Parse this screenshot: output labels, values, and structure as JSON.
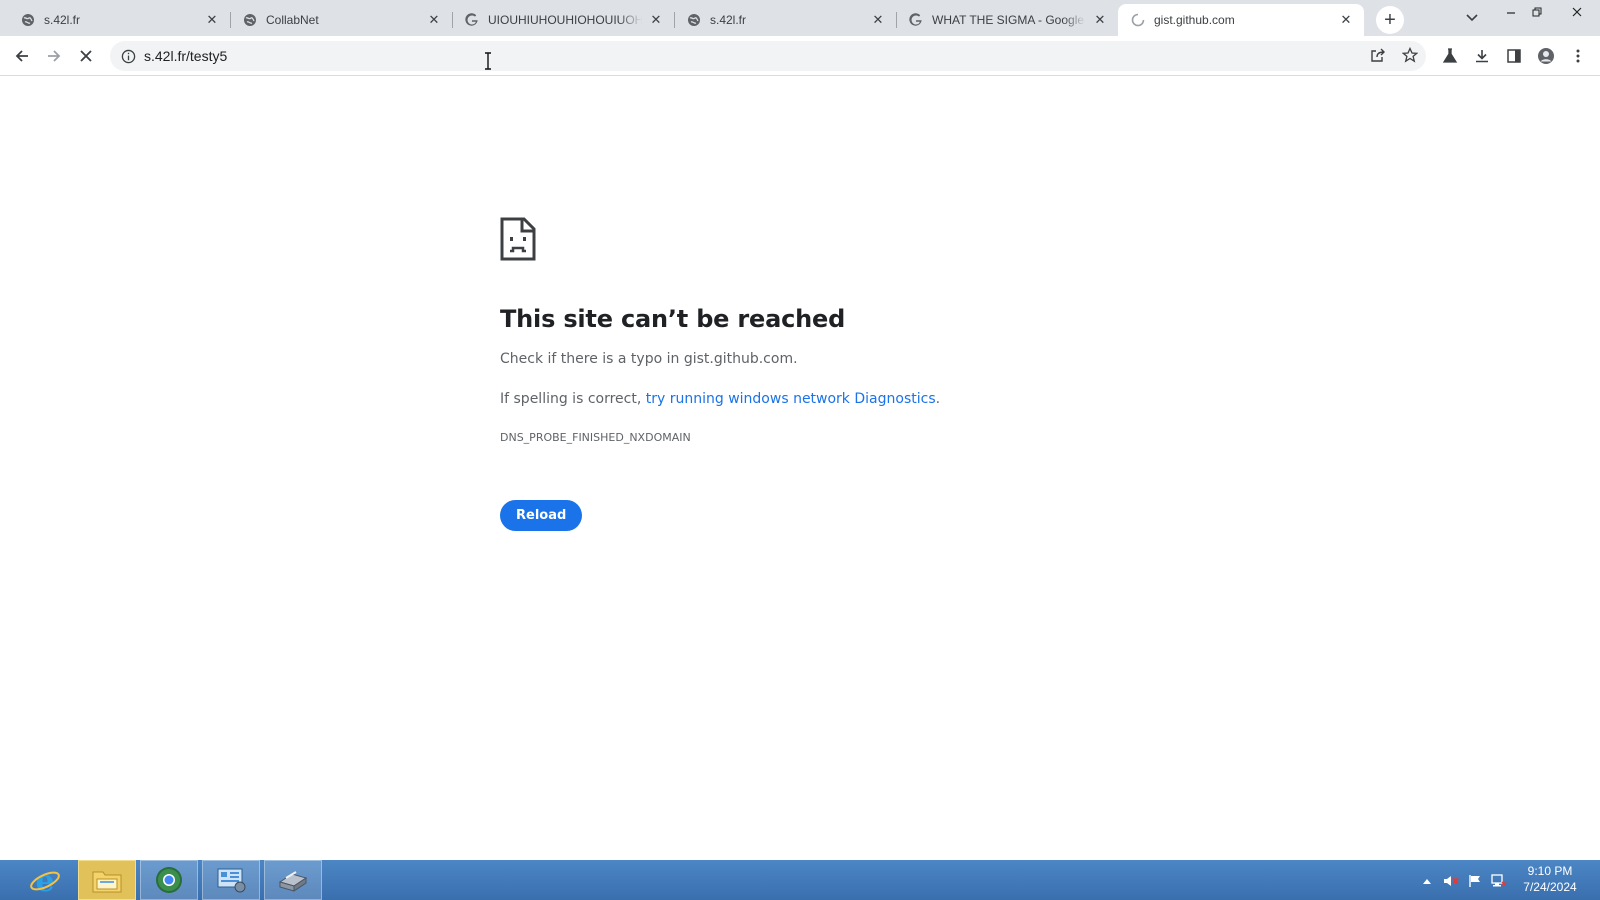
{
  "tabs": [
    {
      "title": "s.42l.fr",
      "favicon": "globe-icon"
    },
    {
      "title": "CollabNet",
      "favicon": "globe-icon"
    },
    {
      "title": "UIOUHIUHOUHIOHOUIUOHI",
      "favicon": "google-icon"
    },
    {
      "title": "s.42l.fr",
      "favicon": "globe-icon"
    },
    {
      "title": "WHAT THE SIGMA - Google S",
      "favicon": "google-icon"
    },
    {
      "title": "gist.github.com",
      "favicon": "loading-spinner-icon",
      "active": true
    }
  ],
  "toolbar": {
    "url": "s.42l.fr/testy5"
  },
  "error_page": {
    "title": "This site can’t be reached",
    "line1": "Check if there is a typo in gist.github.com.",
    "line2_prefix": "If spelling is correct, ",
    "line2_link": "try running windows network Diagnostics",
    "line2_suffix": ".",
    "error_code": "DNS_PROBE_FINISHED_NXDOMAIN",
    "reload_label": "Reload"
  },
  "taskbar": {
    "apps": [
      "internet-explorer-icon",
      "file-explorer-icon",
      "chrome-icon",
      "control-panel-icon",
      "server-manager-icon"
    ],
    "clock_time": "9:10 PM",
    "clock_date": "7/24/2024"
  },
  "colors": {
    "accent": "#1a73e8",
    "tabstrip": "#dee1e6",
    "taskbar": "#3f78b8"
  }
}
